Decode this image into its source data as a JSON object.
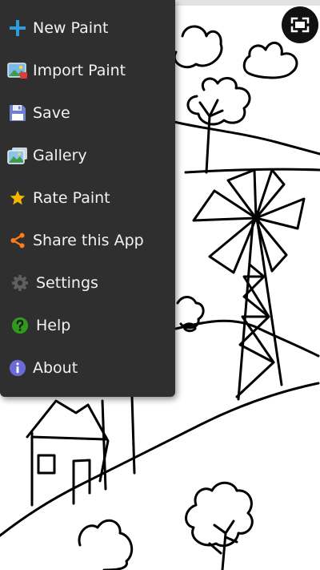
{
  "menu": {
    "items": [
      {
        "label": "New Paint",
        "icon": "plus-icon"
      },
      {
        "label": "Import Paint",
        "icon": "image-import-icon"
      },
      {
        "label": "Save",
        "icon": "floppy-disk-icon"
      },
      {
        "label": "Gallery",
        "icon": "gallery-icon"
      },
      {
        "label": "Rate Paint",
        "icon": "star-icon"
      },
      {
        "label": "Share this App",
        "icon": "share-icon"
      },
      {
        "label": "Settings",
        "icon": "gear-icon"
      },
      {
        "label": "Help",
        "icon": "help-icon"
      },
      {
        "label": "About",
        "icon": "info-icon"
      }
    ]
  },
  "colors": {
    "menu_background": "#2f2f2f",
    "menu_text": "#f2f2f2",
    "plus": "#2f9bdc",
    "star": "#f4b400",
    "share": "#ff7a1a",
    "gear": "#5f5f5f",
    "help": "#2e9b1b",
    "info": "#6b6bd6"
  }
}
